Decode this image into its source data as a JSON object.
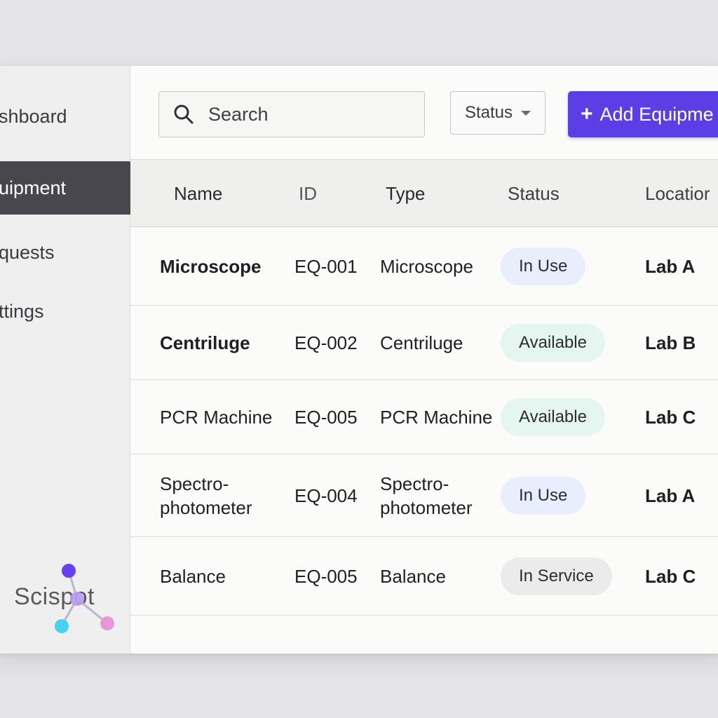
{
  "sidebar": {
    "items": [
      {
        "label": "Dashboard",
        "visible": "shboard"
      },
      {
        "label": "Equipment",
        "visible": "uipment",
        "active": true
      },
      {
        "label": "Requests",
        "visible": "quests"
      },
      {
        "label": "Settings",
        "visible": "ttings"
      }
    ],
    "logo_text": "Scispot"
  },
  "toolbar": {
    "search_placeholder": "Search",
    "status_filter_label": "Status",
    "add_button_label": "Add Equipment",
    "add_button_visible": "Add Equipme"
  },
  "table": {
    "headers": {
      "name": "Name",
      "id": "ID",
      "type": "Type",
      "status": "Status",
      "location": "Location"
    },
    "headers_visible": {
      "location": "Locatior"
    },
    "rows": [
      {
        "name": "Microscope",
        "id": "EQ-001",
        "type": "Microscope",
        "status": "In Use",
        "location": "Lab A",
        "status_kind": "in-use"
      },
      {
        "name": "Centriluge",
        "id": "EQ-002",
        "type": "Centriluge",
        "status": "Available",
        "location": "Lab B",
        "status_kind": "available"
      },
      {
        "name": "PCR Machine",
        "id": "EQ-005",
        "type": "PCR Machine",
        "status": "Available",
        "location": "Lab C",
        "status_kind": "available"
      },
      {
        "name": "Spectro-photometer",
        "id": "EQ-004",
        "type": "Spectro-photometer",
        "status": "In Use",
        "location": "Lab A",
        "status_kind": "in-use"
      },
      {
        "name": "Balance",
        "id": "EQ-005",
        "type": "Balance",
        "status": "In Service",
        "location": "Lab C",
        "status_kind": "in-service"
      }
    ]
  },
  "colors": {
    "accent": "#5b3ee6",
    "sidebar_active": "#48474d",
    "badge_in_use": "#e8eefb",
    "badge_available": "#e5f5ef",
    "badge_in_service": "#ebebeb"
  },
  "icons": {
    "search": "search-icon",
    "caret": "chevron-down-icon",
    "plus": "plus-icon",
    "logo": "molecule-logo-icon"
  }
}
